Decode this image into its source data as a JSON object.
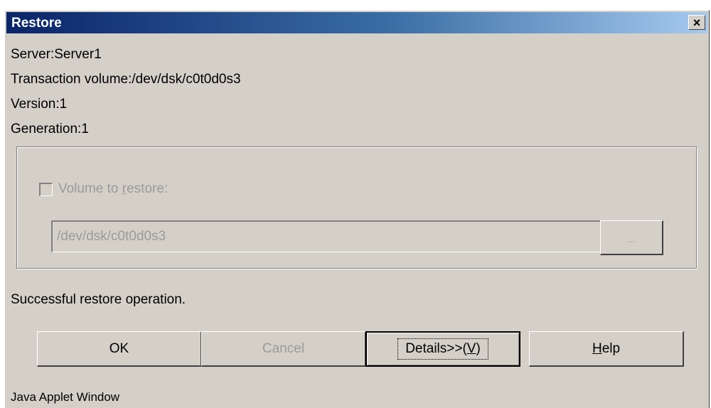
{
  "window": {
    "title": "Restore",
    "close_glyph": "×"
  },
  "info": {
    "server": "Server:Server1",
    "transaction_volume": "Transaction volume:/dev/dsk/c0t0d0s3",
    "version": "Version:1",
    "generation": "Generation:1"
  },
  "restore_group": {
    "checkbox_checked": false,
    "checkbox_enabled": false,
    "checkbox_label_prefix": "Volume to ",
    "checkbox_label_mnemonic": "r",
    "checkbox_label_suffix": "estore:",
    "path_value": "/dev/dsk/c0t0d0s3",
    "browse_label": "..."
  },
  "status_message": "Successful restore operation.",
  "buttons": {
    "ok": "OK",
    "cancel": "Cancel",
    "details_prefix": "Details>>(",
    "details_mnemonic": "V",
    "details_suffix": ")",
    "help_mnemonic": "H",
    "help_suffix": "elp"
  },
  "footer": "Java Applet Window",
  "colors": {
    "title_gradient_start": "#0a246a",
    "title_gradient_end": "#a6caf0",
    "face": "#d4d0c8",
    "disabled_text": "#9a9a9a"
  }
}
